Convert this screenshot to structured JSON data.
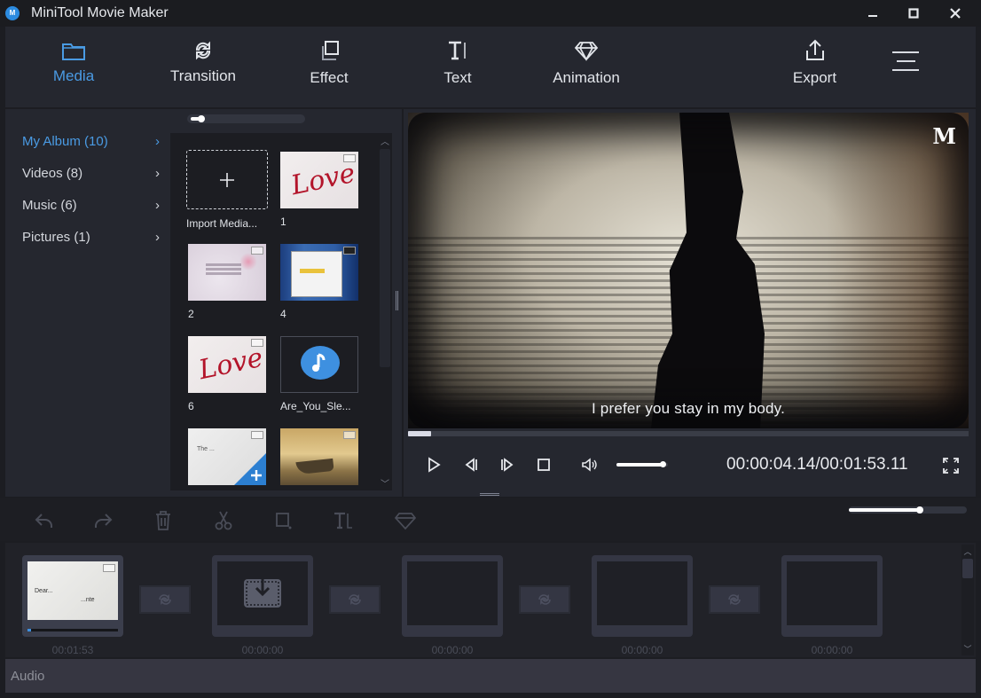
{
  "window": {
    "title": "MiniTool Movie Maker",
    "logo_glyph": "M",
    "controls": {
      "minimize": "minimize",
      "maximize": "maximize",
      "close": "close"
    }
  },
  "toolbar": {
    "items": [
      {
        "label": "Media",
        "icon": "folder-icon",
        "active": true
      },
      {
        "label": "Transition",
        "icon": "transition-icon",
        "active": false
      },
      {
        "label": "Effect",
        "icon": "effect-icon",
        "active": false
      },
      {
        "label": "Text",
        "icon": "text-icon",
        "active": false
      },
      {
        "label": "Animation",
        "icon": "diamond-icon",
        "active": false
      }
    ],
    "export_label": "Export",
    "menu_icon": "hamburger-menu-icon"
  },
  "sidebar": {
    "categories": [
      {
        "label": "My Album (10)",
        "active": true
      },
      {
        "label": "Videos (8)",
        "active": false
      },
      {
        "label": "Music (6)",
        "active": false
      },
      {
        "label": "Pictures (1)",
        "active": false
      }
    ]
  },
  "media": {
    "thumbnail_size_level": 0.1,
    "items": [
      {
        "label": "Import Media...",
        "kind": "import"
      },
      {
        "label": "1",
        "kind": "video",
        "thumb": "love-red"
      },
      {
        "label": "2",
        "kind": "video",
        "thumb": "petals"
      },
      {
        "label": "4",
        "kind": "video",
        "thumb": "screenshot"
      },
      {
        "label": "6",
        "kind": "video",
        "thumb": "love-red"
      },
      {
        "label": "Are_You_Sle...",
        "kind": "audio",
        "thumb": "music"
      },
      {
        "label": "",
        "kind": "video",
        "thumb": "paper-white",
        "add_overlay": true
      },
      {
        "label": "",
        "kind": "video",
        "thumb": "boat-sepia"
      }
    ]
  },
  "player": {
    "subtitle": "I prefer you stay in my body.",
    "watermark": "M",
    "current_time": "00:00:04.14",
    "total_time": "00:01:53.11",
    "timecode": "00:00:04.14/00:01:53.11",
    "progress": 0.037,
    "volume": 0.9,
    "controls": [
      "play",
      "previous-frame",
      "next-frame",
      "stop",
      "volume",
      "fullscreen"
    ]
  },
  "edit_toolbar": {
    "buttons": [
      "undo",
      "redo",
      "delete",
      "split",
      "crop",
      "text",
      "animation"
    ],
    "zoom_level": 0.6
  },
  "timeline": {
    "clips": [
      {
        "time": "00:01:53",
        "filled": true
      },
      {
        "time": "00:00:00",
        "filled": false,
        "drop_target": true
      },
      {
        "time": "00:00:00",
        "filled": false
      },
      {
        "time": "00:00:00",
        "filled": false
      },
      {
        "time": "00:00:00",
        "filled": false
      }
    ],
    "audio_label": "Audio"
  },
  "colors": {
    "accent": "#4a9be4",
    "background": "#1c1d22",
    "panel": "#25272f",
    "timeline_slot": "#343643"
  }
}
